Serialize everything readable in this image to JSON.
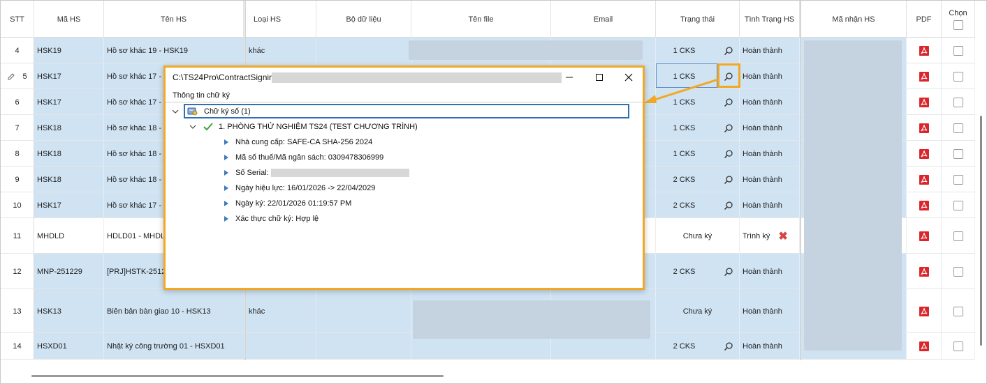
{
  "columns": [
    "STT",
    "Mã HS",
    "Tên HS",
    "Loại HS",
    "Bộ dữ liệu",
    "Tên file",
    "Email",
    "Trạng thái",
    "Tình Trạng HS",
    "Mã nhận HS",
    "PDF",
    "Chọn"
  ],
  "rows": [
    {
      "stt": "4",
      "ma": "HSK19",
      "ten": "Hồ sơ khác 19 - HSK19",
      "loai": "khác",
      "trang_thai": "1 CKS",
      "tinh_trang": "Hoàn thành"
    },
    {
      "stt": "5",
      "ma": "HSK17",
      "ten": "Hồ sơ khác 17 -",
      "loai": "",
      "trang_thai": "1 CKS",
      "tinh_trang": "Hoàn thành"
    },
    {
      "stt": "6",
      "ma": "HSK17",
      "ten": "Hồ sơ khác 17 -",
      "loai": "",
      "trang_thai": "1 CKS",
      "tinh_trang": "Hoàn thành"
    },
    {
      "stt": "7",
      "ma": "HSK18",
      "ten": "Hồ sơ khác 18 -",
      "loai": "",
      "trang_thai": "1 CKS",
      "tinh_trang": "Hoàn thành"
    },
    {
      "stt": "8",
      "ma": "HSK18",
      "ten": "Hồ sơ khác 18 -",
      "loai": "",
      "trang_thai": "1 CKS",
      "tinh_trang": "Hoàn thành"
    },
    {
      "stt": "9",
      "ma": "HSK18",
      "ten": "Hồ sơ khác 18 -",
      "loai": "",
      "trang_thai": "2 CKS",
      "tinh_trang": "Hoàn thành"
    },
    {
      "stt": "10",
      "ma": "HSK17",
      "ten": "Hồ sơ khác 17 -",
      "loai": "",
      "trang_thai": "2 CKS",
      "tinh_trang": "Hoàn thành"
    },
    {
      "stt": "11",
      "ma": "MHDLD",
      "ten": "HDLD01 - MHDL",
      "loai": "",
      "trang_thai": "Chưa ký",
      "tinh_trang": "Trình ký"
    },
    {
      "stt": "12",
      "ma": "MNP-251229",
      "ten": "[PRJ]HSTK-25122",
      "loai": "",
      "trang_thai": "2 CKS",
      "tinh_trang": "Hoàn thành"
    },
    {
      "stt": "13",
      "ma": "HSK13",
      "ten": "Biên bản bàn giao 10 - HSK13",
      "loai": "khác",
      "trang_thai": "Chưa ký",
      "tinh_trang": "Hoàn thành"
    },
    {
      "stt": "14",
      "ma": "HSXD01",
      "ten": "Nhật ký công trường 01 - HSXD01",
      "loai": "",
      "trang_thai": "2 CKS",
      "tinh_trang": "Hoàn thành"
    }
  ],
  "dialog": {
    "title": "C:\\TS24Pro\\ContractSigning",
    "section": "Thông tin chữ ký",
    "root": "Chữ ký số (1)",
    "signer": "1. PHÒNG THỬ NGHIỆM TS24 (TEST CHƯƠNG TRÌNH)",
    "details": [
      "Nhà cung cấp: SAFE-CA SHA-256 2024",
      "Mã số thuế/Mã ngân sách: 0309478306999",
      "Số Serial:",
      "Ngày hiệu lực: 16/01/2026 -> 22/04/2029",
      "Ngày ký: 22/01/2026 01:19:57 PM",
      "Xác thực chữ ký: Hợp lệ"
    ]
  },
  "colors": {
    "selected_row": "#cfe3f3",
    "highlight": "#f2a823",
    "pdf": "#d9262b"
  }
}
